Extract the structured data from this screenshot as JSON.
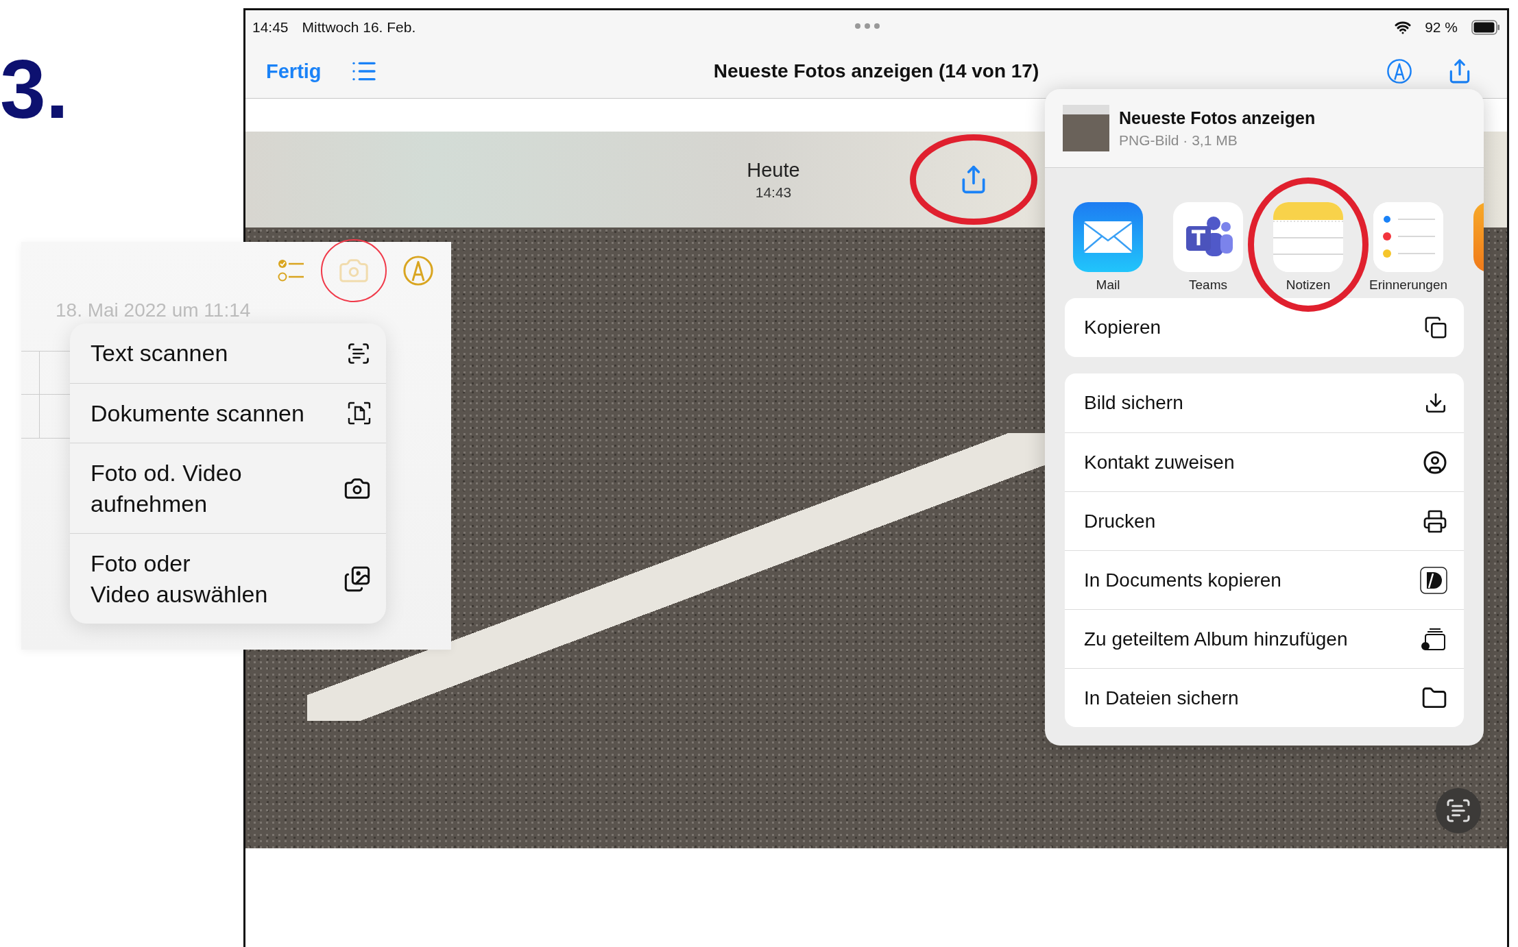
{
  "step_number": "3.",
  "status_bar": {
    "time": "14:45",
    "date": "Mittwoch 16. Feb.",
    "battery": "92 %"
  },
  "nav_bar": {
    "done": "Fertig",
    "title": "Neueste Fotos anzeigen (14 von 17)"
  },
  "photo_header": {
    "day": "Heute",
    "time": "14:43",
    "share_highlighted": true
  },
  "share_sheet": {
    "title": "Neueste Fotos anzeigen",
    "subtitle": "PNG-Bild · 3,1 MB",
    "apps": [
      {
        "kind": "mail",
        "label": "Mail",
        "highlighted": false
      },
      {
        "kind": "teams",
        "label": "Teams",
        "highlighted": false
      },
      {
        "kind": "notes",
        "label": "Notizen",
        "highlighted": true
      },
      {
        "kind": "reminders",
        "label": "Erinnerungen",
        "highlighted": false
      }
    ],
    "action_groups": [
      {
        "actions": [
          {
            "kind": "copy",
            "label": "Kopieren"
          }
        ]
      },
      {
        "actions": [
          {
            "kind": "save-image",
            "label": "Bild sichern"
          },
          {
            "kind": "contact",
            "label": "Kontakt zuweisen"
          },
          {
            "kind": "print",
            "label": "Drucken"
          },
          {
            "kind": "documents",
            "label": "In Documents kopieren"
          },
          {
            "kind": "shared-album",
            "label": "Zu geteiltem Album hinzufügen"
          },
          {
            "kind": "files",
            "label": "In Dateien sichern"
          }
        ]
      }
    ]
  },
  "notes_panel": {
    "date": "18. Mai 2022 um 11:14",
    "camera_highlighted": true,
    "menu": [
      {
        "kind": "scan-text",
        "label": "Text scannen"
      },
      {
        "kind": "scan-documents",
        "label": "Dokumente scannen"
      },
      {
        "kind": "camera",
        "label": "Foto od. Video\naufnehmen"
      },
      {
        "kind": "photos",
        "label": "Foto oder\nVideo auswählen"
      }
    ]
  }
}
